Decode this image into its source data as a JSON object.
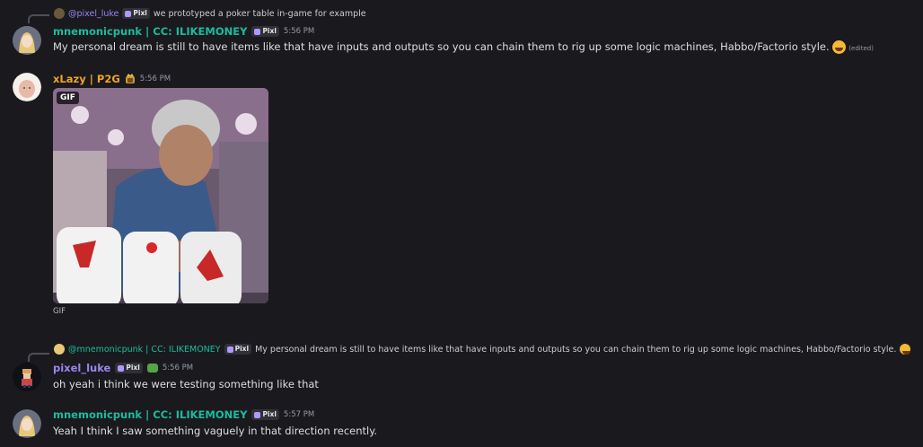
{
  "msg1": {
    "reply": {
      "name": "@pixel_luke",
      "tag": "Pixl",
      "text": "we prototyped a poker table in-game for example"
    },
    "author": "mnemonicpunk | CC: ILIKEMONEY",
    "tag": "Pixl",
    "time": "5:56 PM",
    "text": "My personal dream is still to have items like that have inputs and outputs so you can chain them to rig up some logic machines, Habbo/Factorio style.",
    "edited": "(edited)"
  },
  "msg2": {
    "author": "xLazy | P2G",
    "time": "5:56 PM",
    "gif_badge": "GIF",
    "gif_caption": "GIF"
  },
  "msg3": {
    "reply": {
      "name": "@mnemonicpunk | CC: ILIKEMONEY",
      "tag": "Pixl",
      "text": "My personal dream is still to have items like that have inputs and outputs so you can chain them to rig up some logic machines, Habbo/Factorio style."
    },
    "author": "pixel_luke",
    "tag": "Pixl",
    "time": "5:56 PM",
    "text": "oh yeah i think we were testing something like that"
  },
  "msg4": {
    "author": "mnemonicpunk | CC: ILIKEMONEY",
    "tag": "Pixl",
    "time": "5:57 PM",
    "text": "Yeah I think I saw something vaguely in that direction recently."
  },
  "colors": {
    "teal": "#1abc9c",
    "orange": "#f1a22a",
    "purple": "#9b84ee",
    "background": "#1a1a1e"
  }
}
